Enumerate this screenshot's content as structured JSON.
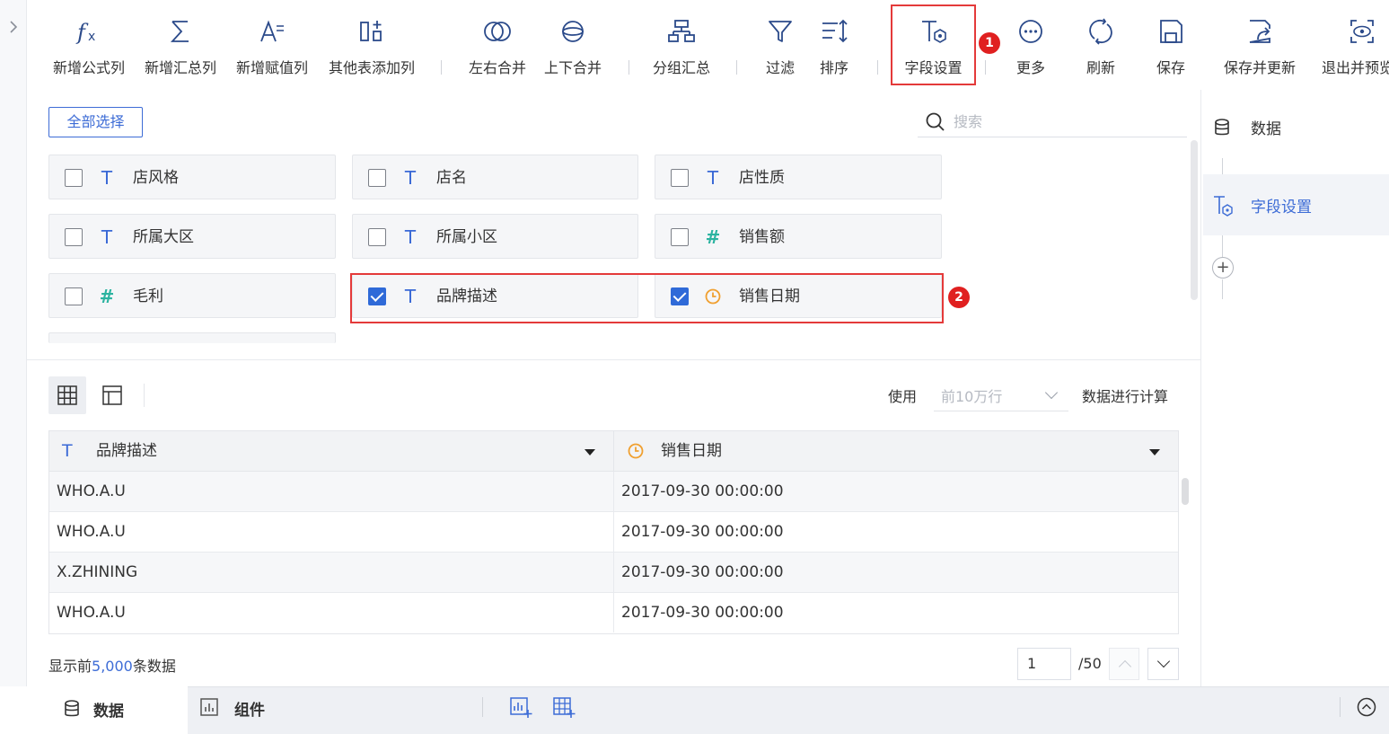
{
  "toolbar": {
    "items": [
      {
        "label": "新增公式列",
        "icon": "formula-icon"
      },
      {
        "label": "新增汇总列",
        "icon": "sigma-icon"
      },
      {
        "label": "新增赋值列",
        "icon": "assign-column-icon"
      },
      {
        "label": "其他表添加列",
        "icon": "add-column-icon"
      },
      {
        "label": "左右合并",
        "icon": "merge-horizontal-icon"
      },
      {
        "label": "上下合并",
        "icon": "merge-vertical-icon"
      },
      {
        "label": "分组汇总",
        "icon": "group-summary-icon"
      },
      {
        "label": "过滤",
        "icon": "filter-icon"
      },
      {
        "label": "排序",
        "icon": "sort-icon"
      },
      {
        "label": "字段设置",
        "icon": "field-settings-icon"
      },
      {
        "label": "更多",
        "icon": "more-icon"
      },
      {
        "label": "刷新",
        "icon": "refresh-icon"
      },
      {
        "label": "保存",
        "icon": "save-icon"
      },
      {
        "label": "保存并更新",
        "icon": "save-update-icon"
      },
      {
        "label": "退出并预览",
        "icon": "exit-preview-icon"
      }
    ]
  },
  "annotations": {
    "badge1": "1",
    "badge2": "2"
  },
  "fields": {
    "select_all": "全部选择",
    "search_placeholder": "搜索",
    "items": [
      {
        "label": "店风格",
        "type": "text",
        "checked": false
      },
      {
        "label": "店名",
        "type": "text",
        "checked": false
      },
      {
        "label": "店性质",
        "type": "text",
        "checked": false
      },
      {
        "label": "所属大区",
        "type": "text",
        "checked": false
      },
      {
        "label": "所属小区",
        "type": "text",
        "checked": false
      },
      {
        "label": "销售额",
        "type": "number",
        "checked": false
      },
      {
        "label": "毛利",
        "type": "number",
        "checked": false
      },
      {
        "label": "品牌描述",
        "type": "text",
        "checked": true
      },
      {
        "label": "销售日期",
        "type": "date",
        "checked": true
      }
    ],
    "icons": {
      "text": "T",
      "number": "#"
    }
  },
  "right_panel": {
    "steps": [
      {
        "label": "数据",
        "icon": "database-icon"
      },
      {
        "label": "字段设置",
        "icon": "field-settings-icon"
      }
    ],
    "add": "+"
  },
  "preview": {
    "use_label": "使用",
    "rows_option": "前10万行",
    "calc_label": "数据进行计算",
    "columns": [
      {
        "label": "品牌描述",
        "type": "text"
      },
      {
        "label": "销售日期",
        "type": "date"
      }
    ],
    "rows": [
      [
        "WHO.A.U",
        "2017-09-30 00:00:00"
      ],
      [
        "WHO.A.U",
        "2017-09-30 00:00:00"
      ],
      [
        "X.ZHINING",
        "2017-09-30 00:00:00"
      ],
      [
        "WHO.A.U",
        "2017-09-30 00:00:00"
      ]
    ],
    "showing_prefix": "显示前",
    "showing_count": "5,000",
    "showing_suffix": "条数据",
    "page": "1",
    "page_total": "/50"
  },
  "bottom": {
    "tab_data": "数据",
    "tab_component": "组件"
  },
  "colors": {
    "accent": "#3d6cd6",
    "highlight": "#e43a3a",
    "date": "#f0a030",
    "number": "#2bb3a0"
  }
}
